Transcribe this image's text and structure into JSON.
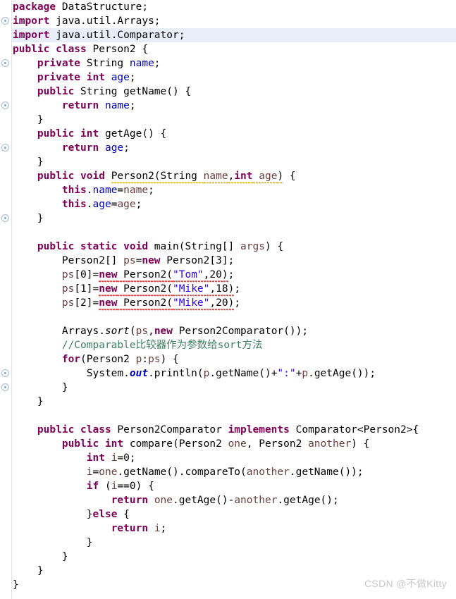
{
  "editor": {
    "language": "java",
    "current_line": 3,
    "colors": {
      "background": "#ffffff",
      "keyword": "#7f0055",
      "field": "#0000c0",
      "string": "#2a00ff",
      "comment": "#3f7f5f",
      "parameter": "#6a3e3e",
      "plain": "#000000",
      "current_line_highlight": "#e8effb",
      "gutter_border": "#e4e4e4",
      "error_squiggle": "#e01b1b",
      "warning_squiggle": "#d4b400",
      "watermark": "#c9c9c9"
    }
  },
  "gutter": {
    "fold_marker_lines": [
      2,
      5,
      8,
      11,
      16,
      27,
      28
    ],
    "icon": "fold-collapse-icon"
  },
  "watermark": {
    "text": "CSDN @不做Kitty"
  },
  "lines": [
    {
      "n": 1,
      "tokens": [
        {
          "t": "package",
          "c": "kw"
        },
        {
          "t": " DataStructure;",
          "c": "pl"
        }
      ]
    },
    {
      "n": 2,
      "tokens": [
        {
          "t": "import",
          "c": "kw"
        },
        {
          "t": " java.util.Arrays;",
          "c": "pl"
        }
      ]
    },
    {
      "n": 3,
      "tokens": [
        {
          "t": "import",
          "c": "kw"
        },
        {
          "t": " java.util.Comparator;",
          "c": "pl"
        }
      ]
    },
    {
      "n": 4,
      "tokens": [
        {
          "t": "public class",
          "c": "kw"
        },
        {
          "t": " Person2 {",
          "c": "pl"
        }
      ]
    },
    {
      "n": 5,
      "tokens": [
        {
          "t": "    ",
          "c": "pl"
        },
        {
          "t": "private",
          "c": "kw"
        },
        {
          "t": " String ",
          "c": "pl"
        },
        {
          "t": "name",
          "c": "fld"
        },
        {
          "t": ";",
          "c": "pl"
        }
      ]
    },
    {
      "n": 6,
      "tokens": [
        {
          "t": "    ",
          "c": "pl"
        },
        {
          "t": "private int",
          "c": "kw"
        },
        {
          "t": " ",
          "c": "pl"
        },
        {
          "t": "age",
          "c": "fld"
        },
        {
          "t": ";",
          "c": "pl"
        }
      ]
    },
    {
      "n": 7,
      "tokens": [
        {
          "t": "    ",
          "c": "pl"
        },
        {
          "t": "public",
          "c": "kw"
        },
        {
          "t": " String getName() {",
          "c": "pl"
        }
      ]
    },
    {
      "n": 8,
      "tokens": [
        {
          "t": "        ",
          "c": "pl"
        },
        {
          "t": "return",
          "c": "kw"
        },
        {
          "t": " ",
          "c": "pl"
        },
        {
          "t": "name",
          "c": "fld"
        },
        {
          "t": ";",
          "c": "pl"
        }
      ]
    },
    {
      "n": 9,
      "tokens": [
        {
          "t": "    }",
          "c": "pl"
        }
      ]
    },
    {
      "n": 10,
      "tokens": [
        {
          "t": "    ",
          "c": "pl"
        },
        {
          "t": "public int",
          "c": "kw"
        },
        {
          "t": " getAge() {",
          "c": "pl"
        }
      ]
    },
    {
      "n": 11,
      "tokens": [
        {
          "t": "        ",
          "c": "pl"
        },
        {
          "t": "return",
          "c": "kw"
        },
        {
          "t": " ",
          "c": "pl"
        },
        {
          "t": "age",
          "c": "fld"
        },
        {
          "t": ";",
          "c": "pl"
        }
      ]
    },
    {
      "n": 12,
      "tokens": [
        {
          "t": "    }",
          "c": "pl"
        }
      ]
    },
    {
      "n": 13,
      "tokens": [
        {
          "t": "    ",
          "c": "pl"
        },
        {
          "t": "public void",
          "c": "kw"
        },
        {
          "t": " ",
          "c": "pl"
        },
        {
          "t": "Person2(String ",
          "c": "pl",
          "u": "warn"
        },
        {
          "t": "name",
          "c": "par",
          "u": "warn"
        },
        {
          "t": ",",
          "c": "pl",
          "u": "warn"
        },
        {
          "t": "int",
          "c": "kw",
          "u": "warn"
        },
        {
          "t": " ",
          "c": "pl",
          "u": "warn"
        },
        {
          "t": "age",
          "c": "par",
          "u": "warn"
        },
        {
          "t": ")",
          "c": "pl",
          "u": "warn"
        },
        {
          "t": " {",
          "c": "pl"
        }
      ]
    },
    {
      "n": 14,
      "tokens": [
        {
          "t": "        ",
          "c": "pl"
        },
        {
          "t": "this",
          "c": "kw"
        },
        {
          "t": ".",
          "c": "pl"
        },
        {
          "t": "name",
          "c": "fld"
        },
        {
          "t": "=",
          "c": "pl"
        },
        {
          "t": "name",
          "c": "par"
        },
        {
          "t": ";",
          "c": "pl"
        }
      ]
    },
    {
      "n": 15,
      "tokens": [
        {
          "t": "        ",
          "c": "pl"
        },
        {
          "t": "this",
          "c": "kw"
        },
        {
          "t": ".",
          "c": "pl"
        },
        {
          "t": "age",
          "c": "fld"
        },
        {
          "t": "=",
          "c": "pl"
        },
        {
          "t": "age",
          "c": "par"
        },
        {
          "t": ";",
          "c": "pl"
        }
      ]
    },
    {
      "n": 16,
      "tokens": [
        {
          "t": "    }",
          "c": "pl"
        }
      ]
    },
    {
      "n": 17,
      "tokens": [
        {
          "t": "",
          "c": "pl"
        }
      ]
    },
    {
      "n": 18,
      "tokens": [
        {
          "t": "    ",
          "c": "pl"
        },
        {
          "t": "public static void",
          "c": "kw"
        },
        {
          "t": " main(String[] ",
          "c": "pl"
        },
        {
          "t": "args",
          "c": "par"
        },
        {
          "t": ") {",
          "c": "pl"
        }
      ]
    },
    {
      "n": 19,
      "tokens": [
        {
          "t": "        Person2[] ",
          "c": "pl"
        },
        {
          "t": "ps",
          "c": "par"
        },
        {
          "t": "=",
          "c": "pl"
        },
        {
          "t": "new",
          "c": "kw"
        },
        {
          "t": " Person2[3];",
          "c": "pl"
        }
      ]
    },
    {
      "n": 20,
      "tokens": [
        {
          "t": "        ",
          "c": "pl"
        },
        {
          "t": "ps",
          "c": "par"
        },
        {
          "t": "[0]=",
          "c": "pl"
        },
        {
          "t": "new",
          "c": "kw",
          "u": "err"
        },
        {
          "t": " Person2(",
          "c": "pl",
          "u": "err"
        },
        {
          "t": "\"Tom\"",
          "c": "str",
          "u": "err"
        },
        {
          "t": ",20)",
          "c": "pl",
          "u": "err"
        },
        {
          "t": ";",
          "c": "pl"
        }
      ]
    },
    {
      "n": 21,
      "tokens": [
        {
          "t": "        ",
          "c": "pl"
        },
        {
          "t": "ps",
          "c": "par"
        },
        {
          "t": "[1]=",
          "c": "pl"
        },
        {
          "t": "new",
          "c": "kw",
          "u": "err"
        },
        {
          "t": " Person2(",
          "c": "pl",
          "u": "err"
        },
        {
          "t": "\"Mike\"",
          "c": "str",
          "u": "err"
        },
        {
          "t": ",18)",
          "c": "pl",
          "u": "err"
        },
        {
          "t": ";",
          "c": "pl"
        }
      ]
    },
    {
      "n": 22,
      "tokens": [
        {
          "t": "        ",
          "c": "pl"
        },
        {
          "t": "ps",
          "c": "par"
        },
        {
          "t": "[2]=",
          "c": "pl"
        },
        {
          "t": "new",
          "c": "kw",
          "u": "err"
        },
        {
          "t": " Person2(",
          "c": "pl",
          "u": "err"
        },
        {
          "t": "\"Mike\"",
          "c": "str",
          "u": "err"
        },
        {
          "t": ",20)",
          "c": "pl",
          "u": "err"
        },
        {
          "t": ";",
          "c": "pl"
        }
      ]
    },
    {
      "n": 23,
      "tokens": [
        {
          "t": "",
          "c": "pl"
        }
      ]
    },
    {
      "n": 24,
      "tokens": [
        {
          "t": "        Arrays.",
          "c": "pl"
        },
        {
          "t": "sort",
          "c": "mstat"
        },
        {
          "t": "(",
          "c": "pl"
        },
        {
          "t": "ps",
          "c": "par"
        },
        {
          "t": ",",
          "c": "pl"
        },
        {
          "t": "new",
          "c": "kw"
        },
        {
          "t": " Person2Comparator());",
          "c": "pl"
        }
      ]
    },
    {
      "n": 25,
      "tokens": [
        {
          "t": "        //Comparable比较器作为参数给sort方法",
          "c": "cmt"
        }
      ]
    },
    {
      "n": 26,
      "tokens": [
        {
          "t": "        ",
          "c": "pl"
        },
        {
          "t": "for",
          "c": "kw"
        },
        {
          "t": "(Person2 ",
          "c": "pl"
        },
        {
          "t": "p",
          "c": "par"
        },
        {
          "t": ":",
          "c": "pl"
        },
        {
          "t": "ps",
          "c": "par"
        },
        {
          "t": ") {",
          "c": "pl"
        }
      ]
    },
    {
      "n": 27,
      "tokens": [
        {
          "t": "            System.",
          "c": "pl"
        },
        {
          "t": "out",
          "c": "stat"
        },
        {
          "t": ".println(",
          "c": "pl"
        },
        {
          "t": "p",
          "c": "par"
        },
        {
          "t": ".getName()+",
          "c": "pl"
        },
        {
          "t": "\":\"",
          "c": "str"
        },
        {
          "t": "+",
          "c": "pl"
        },
        {
          "t": "p",
          "c": "par"
        },
        {
          "t": ".getAge());",
          "c": "pl"
        }
      ]
    },
    {
      "n": 28,
      "tokens": [
        {
          "t": "        }",
          "c": "pl"
        }
      ]
    },
    {
      "n": 29,
      "tokens": [
        {
          "t": "    }",
          "c": "pl"
        }
      ]
    },
    {
      "n": 30,
      "tokens": [
        {
          "t": "",
          "c": "pl"
        }
      ]
    },
    {
      "n": 31,
      "tokens": [
        {
          "t": "    ",
          "c": "pl"
        },
        {
          "t": "public class",
          "c": "kw"
        },
        {
          "t": " Person2Comparator ",
          "c": "pl"
        },
        {
          "t": "implements",
          "c": "kw"
        },
        {
          "t": " Comparator<Person2>{",
          "c": "pl"
        }
      ]
    },
    {
      "n": 32,
      "tokens": [
        {
          "t": "        ",
          "c": "pl"
        },
        {
          "t": "public int",
          "c": "kw"
        },
        {
          "t": " compare(Person2 ",
          "c": "pl"
        },
        {
          "t": "one",
          "c": "par"
        },
        {
          "t": ", Person2 ",
          "c": "pl"
        },
        {
          "t": "another",
          "c": "par"
        },
        {
          "t": ") {",
          "c": "pl"
        }
      ]
    },
    {
      "n": 33,
      "tokens": [
        {
          "t": "            ",
          "c": "pl"
        },
        {
          "t": "int",
          "c": "kw"
        },
        {
          "t": " ",
          "c": "pl"
        },
        {
          "t": "i",
          "c": "par"
        },
        {
          "t": "=0;",
          "c": "pl"
        }
      ]
    },
    {
      "n": 34,
      "tokens": [
        {
          "t": "            ",
          "c": "pl"
        },
        {
          "t": "i",
          "c": "par"
        },
        {
          "t": "=",
          "c": "pl"
        },
        {
          "t": "one",
          "c": "par"
        },
        {
          "t": ".getName().compareTo(",
          "c": "pl"
        },
        {
          "t": "another",
          "c": "par"
        },
        {
          "t": ".getName());",
          "c": "pl"
        }
      ]
    },
    {
      "n": 35,
      "tokens": [
        {
          "t": "            ",
          "c": "pl"
        },
        {
          "t": "if",
          "c": "kw"
        },
        {
          "t": " (",
          "c": "pl"
        },
        {
          "t": "i",
          "c": "par"
        },
        {
          "t": "==0) {",
          "c": "pl"
        }
      ]
    },
    {
      "n": 36,
      "tokens": [
        {
          "t": "                ",
          "c": "pl"
        },
        {
          "t": "return",
          "c": "kw"
        },
        {
          "t": " ",
          "c": "pl"
        },
        {
          "t": "one",
          "c": "par"
        },
        {
          "t": ".getAge()-",
          "c": "pl"
        },
        {
          "t": "another",
          "c": "par"
        },
        {
          "t": ".getAge();",
          "c": "pl"
        }
      ]
    },
    {
      "n": 37,
      "tokens": [
        {
          "t": "            }",
          "c": "pl"
        },
        {
          "t": "else",
          "c": "kw"
        },
        {
          "t": " {",
          "c": "pl"
        }
      ]
    },
    {
      "n": 38,
      "tokens": [
        {
          "t": "                ",
          "c": "pl"
        },
        {
          "t": "return",
          "c": "kw"
        },
        {
          "t": " ",
          "c": "pl"
        },
        {
          "t": "i",
          "c": "par"
        },
        {
          "t": ";",
          "c": "pl"
        }
      ]
    },
    {
      "n": 39,
      "tokens": [
        {
          "t": "            }",
          "c": "pl"
        }
      ]
    },
    {
      "n": 40,
      "tokens": [
        {
          "t": "        }",
          "c": "pl"
        }
      ]
    },
    {
      "n": 41,
      "tokens": [
        {
          "t": "    }",
          "c": "pl"
        }
      ]
    },
    {
      "n": 42,
      "tokens": [
        {
          "t": "}",
          "c": "pl"
        }
      ]
    }
  ]
}
